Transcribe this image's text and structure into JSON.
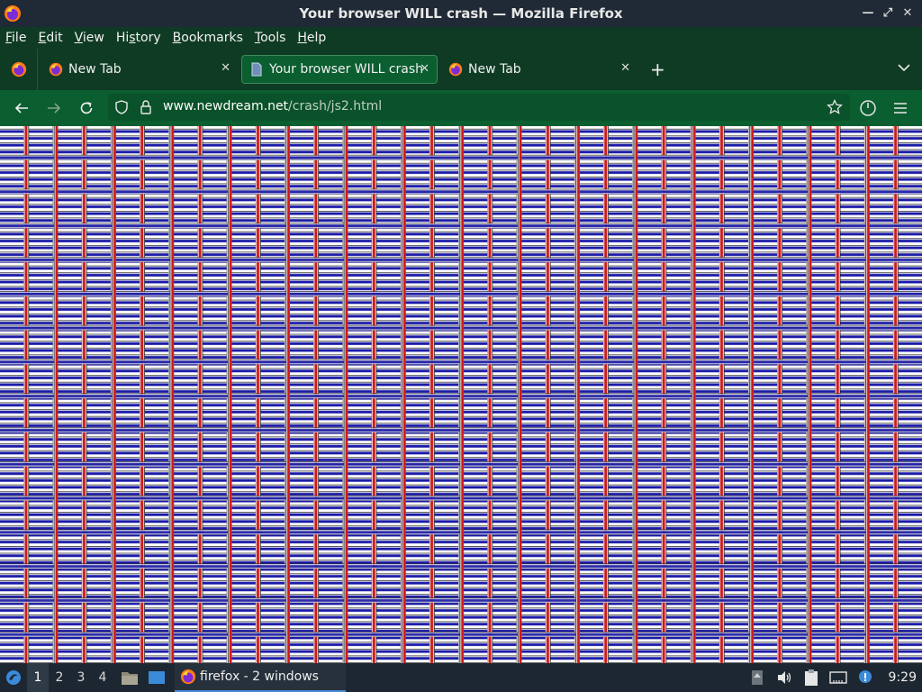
{
  "window": {
    "title": "Your browser WILL crash — Mozilla Firefox",
    "controls": {
      "minimize": "—",
      "restore": "⤢",
      "close": "✕"
    }
  },
  "menubar": {
    "items": [
      {
        "label": "File",
        "key": "F"
      },
      {
        "label": "Edit",
        "key": "E"
      },
      {
        "label": "View",
        "key": "V"
      },
      {
        "label": "History",
        "key": "s"
      },
      {
        "label": "Bookmarks",
        "key": "B"
      },
      {
        "label": "Tools",
        "key": "T"
      },
      {
        "label": "Help",
        "key": "H"
      }
    ]
  },
  "tabs": [
    {
      "label": "New Tab",
      "active": false
    },
    {
      "label": "Your browser WILL crash",
      "active": true
    },
    {
      "label": "New Tab",
      "active": false
    }
  ],
  "tabstrip": {
    "new_tab": "+",
    "list_all": "⌄",
    "close_glyph": "✕"
  },
  "navbar": {
    "url_domain": "www.newdream.net",
    "url_path": "/crash/js2.html"
  },
  "taskbar": {
    "workspaces": [
      "1",
      "2",
      "3",
      "4"
    ],
    "active_workspace": "1",
    "task_label": "firefox - 2 windows",
    "clock": "9:29"
  },
  "colors": {
    "titlebar": "#1f2a36",
    "menubar": "#0f3b24",
    "navbar": "#0b5e30",
    "pattern_red": "#d01818",
    "pattern_blue": "#1a1aa8"
  }
}
